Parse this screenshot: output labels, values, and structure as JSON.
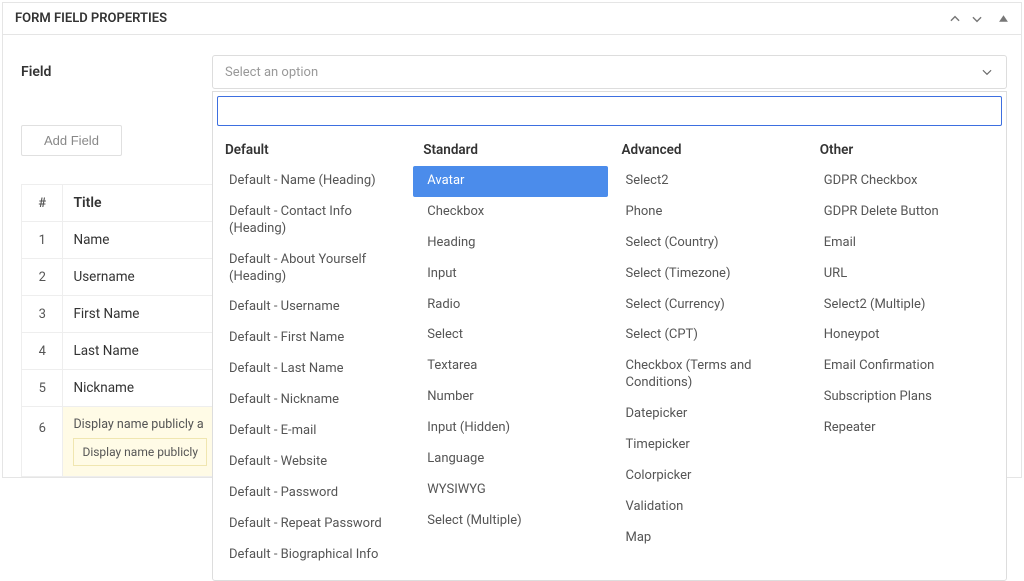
{
  "panel": {
    "title": "FORM FIELD PROPERTIES"
  },
  "field": {
    "label": "Field",
    "placeholder": "Select an option"
  },
  "addFieldLabel": "Add Field",
  "table": {
    "headers": {
      "num": "#",
      "title": "Title"
    },
    "rows": [
      {
        "num": "1",
        "title": "Name"
      },
      {
        "num": "2",
        "title": "Username"
      },
      {
        "num": "3",
        "title": "First Name"
      },
      {
        "num": "4",
        "title": "Last Name"
      },
      {
        "num": "5",
        "title": "Nickname"
      },
      {
        "num": "6",
        "title": "Display name publicly a",
        "warn": "Display name publicly"
      }
    ]
  },
  "groups": {
    "g0": {
      "label": "Default",
      "o0": "Default - Name (Heading)",
      "o1": "Default - Contact Info (Heading)",
      "o2": "Default - About Yourself (Heading)",
      "o3": "Default - Username",
      "o4": "Default - First Name",
      "o5": "Default - Last Name",
      "o6": "Default - Nickname",
      "o7": "Default - E-mail",
      "o8": "Default - Website",
      "o9": "Default - Password",
      "o10": "Default - Repeat Password",
      "o11": "Default - Biographical Info"
    },
    "g1": {
      "label": "Standard",
      "o0": "Avatar",
      "o1": "Checkbox",
      "o2": "Heading",
      "o3": "Input",
      "o4": "Radio",
      "o5": "Select",
      "o6": "Textarea",
      "o7": "Number",
      "o8": "Input (Hidden)",
      "o9": "Language",
      "o10": "WYSIWYG",
      "o11": "Select (Multiple)"
    },
    "g2": {
      "label": "Advanced",
      "o0": "Select2",
      "o1": "Phone",
      "o2": "Select (Country)",
      "o3": "Select (Timezone)",
      "o4": "Select (Currency)",
      "o5": "Select (CPT)",
      "o6": "Checkbox (Terms and Conditions)",
      "o7": "Datepicker",
      "o8": "Timepicker",
      "o9": "Colorpicker",
      "o10": "Validation",
      "o11": "Map"
    },
    "g3": {
      "label": "Other",
      "o0": "GDPR Checkbox",
      "o1": "GDPR Delete Button",
      "o2": "Email",
      "o3": "URL",
      "o4": "Select2 (Multiple)",
      "o5": "Honeypot",
      "o6": "Email Confirmation",
      "o7": "Subscription Plans",
      "o8": "Repeater"
    }
  }
}
